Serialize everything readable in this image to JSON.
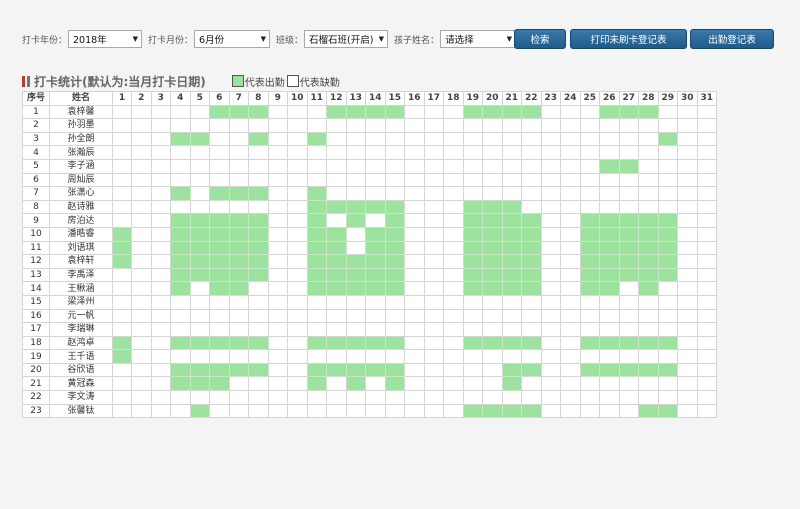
{
  "filters": {
    "year_label": "打卡年份：",
    "year_value": "2018年",
    "month_label": "打卡月份：",
    "month_value": "6月份",
    "class_label": "班级：",
    "class_value": "石榴石班(开启)",
    "child_label": "孩子姓名：",
    "child_value": "请选择"
  },
  "buttons": {
    "search": "检索",
    "print_unswiped": "打印未刷卡登记表",
    "attendance_register": "出勤登记表"
  },
  "section": {
    "title": "打卡统计(默认为:当月打卡日期)",
    "legend_present": "代表出勤",
    "legend_absent": "代表缺勤"
  },
  "colors": {
    "present": "#9ee2a0",
    "absent": "#ffffff",
    "button": "#1f5a8a"
  },
  "table": {
    "header_index": "序号",
    "header_name": "姓名",
    "days": [
      1,
      2,
      3,
      4,
      5,
      6,
      7,
      8,
      9,
      10,
      11,
      12,
      13,
      14,
      15,
      16,
      17,
      18,
      19,
      20,
      21,
      22,
      23,
      24,
      25,
      26,
      27,
      28,
      29,
      30,
      31
    ],
    "rows": [
      {
        "no": "1",
        "name": "袁梓馨",
        "present": [
          6,
          7,
          8,
          12,
          13,
          14,
          15,
          19,
          20,
          21,
          22,
          26,
          27,
          28
        ]
      },
      {
        "no": "2",
        "name": "孙羽墨",
        "present": []
      },
      {
        "no": "3",
        "name": "孙全朗",
        "present": [
          4,
          5,
          8,
          11,
          29
        ]
      },
      {
        "no": "4",
        "name": "张瀚辰",
        "present": []
      },
      {
        "no": "5",
        "name": "李子涵",
        "present": [
          26,
          27
        ]
      },
      {
        "no": "6",
        "name": "周灿辰",
        "present": []
      },
      {
        "no": "7",
        "name": "张潇心",
        "present": [
          4,
          6,
          7,
          8,
          11
        ]
      },
      {
        "no": "8",
        "name": "赵诗雅",
        "present": [
          11,
          12,
          13,
          14,
          15,
          19,
          20,
          21
        ]
      },
      {
        "no": "9",
        "name": "房泊达",
        "present": [
          4,
          5,
          6,
          7,
          8,
          11,
          13,
          15,
          19,
          20,
          21,
          22,
          25,
          26,
          27,
          28,
          29
        ]
      },
      {
        "no": "10",
        "name": "潘晧睿",
        "present": [
          1,
          4,
          5,
          6,
          7,
          8,
          11,
          12,
          14,
          15,
          19,
          20,
          21,
          22,
          25,
          26,
          27,
          28,
          29
        ]
      },
      {
        "no": "11",
        "name": "刘语琪",
        "present": [
          1,
          4,
          5,
          6,
          7,
          8,
          11,
          12,
          14,
          15,
          19,
          20,
          21,
          22,
          25,
          26,
          27,
          28,
          29
        ]
      },
      {
        "no": "12",
        "name": "袁梓轩",
        "present": [
          1,
          4,
          5,
          6,
          7,
          8,
          11,
          12,
          13,
          14,
          15,
          19,
          20,
          21,
          22,
          25,
          26,
          27,
          28,
          29
        ]
      },
      {
        "no": "13",
        "name": "李禹泽",
        "present": [
          4,
          5,
          6,
          7,
          8,
          11,
          12,
          13,
          14,
          15,
          19,
          20,
          21,
          22,
          25,
          26,
          27,
          28,
          29
        ]
      },
      {
        "no": "14",
        "name": "王楸涵",
        "present": [
          4,
          6,
          7,
          11,
          12,
          13,
          14,
          15,
          19,
          20,
          21,
          22,
          25,
          26,
          28
        ]
      },
      {
        "no": "15",
        "name": "梁泽州",
        "present": []
      },
      {
        "no": "16",
        "name": "元一帆",
        "present": []
      },
      {
        "no": "17",
        "name": "李瑞琳",
        "present": []
      },
      {
        "no": "18",
        "name": "赵鸿卓",
        "present": [
          1,
          4,
          5,
          6,
          7,
          8,
          11,
          12,
          13,
          14,
          15,
          19,
          20,
          21,
          22,
          25,
          26,
          27,
          28,
          29
        ]
      },
      {
        "no": "19",
        "name": "王千语",
        "present": [
          1
        ]
      },
      {
        "no": "20",
        "name": "谷欣语",
        "present": [
          4,
          5,
          6,
          7,
          8,
          11,
          12,
          13,
          14,
          15,
          21,
          22,
          25,
          26,
          27,
          28,
          29
        ]
      },
      {
        "no": "21",
        "name": "黄冠森",
        "present": [
          4,
          5,
          6,
          11,
          13,
          15,
          21
        ]
      },
      {
        "no": "22",
        "name": "李文涛",
        "present": []
      },
      {
        "no": "23",
        "name": "张馨钛",
        "present": [
          5,
          19,
          20,
          21,
          22,
          28,
          29
        ]
      }
    ]
  }
}
